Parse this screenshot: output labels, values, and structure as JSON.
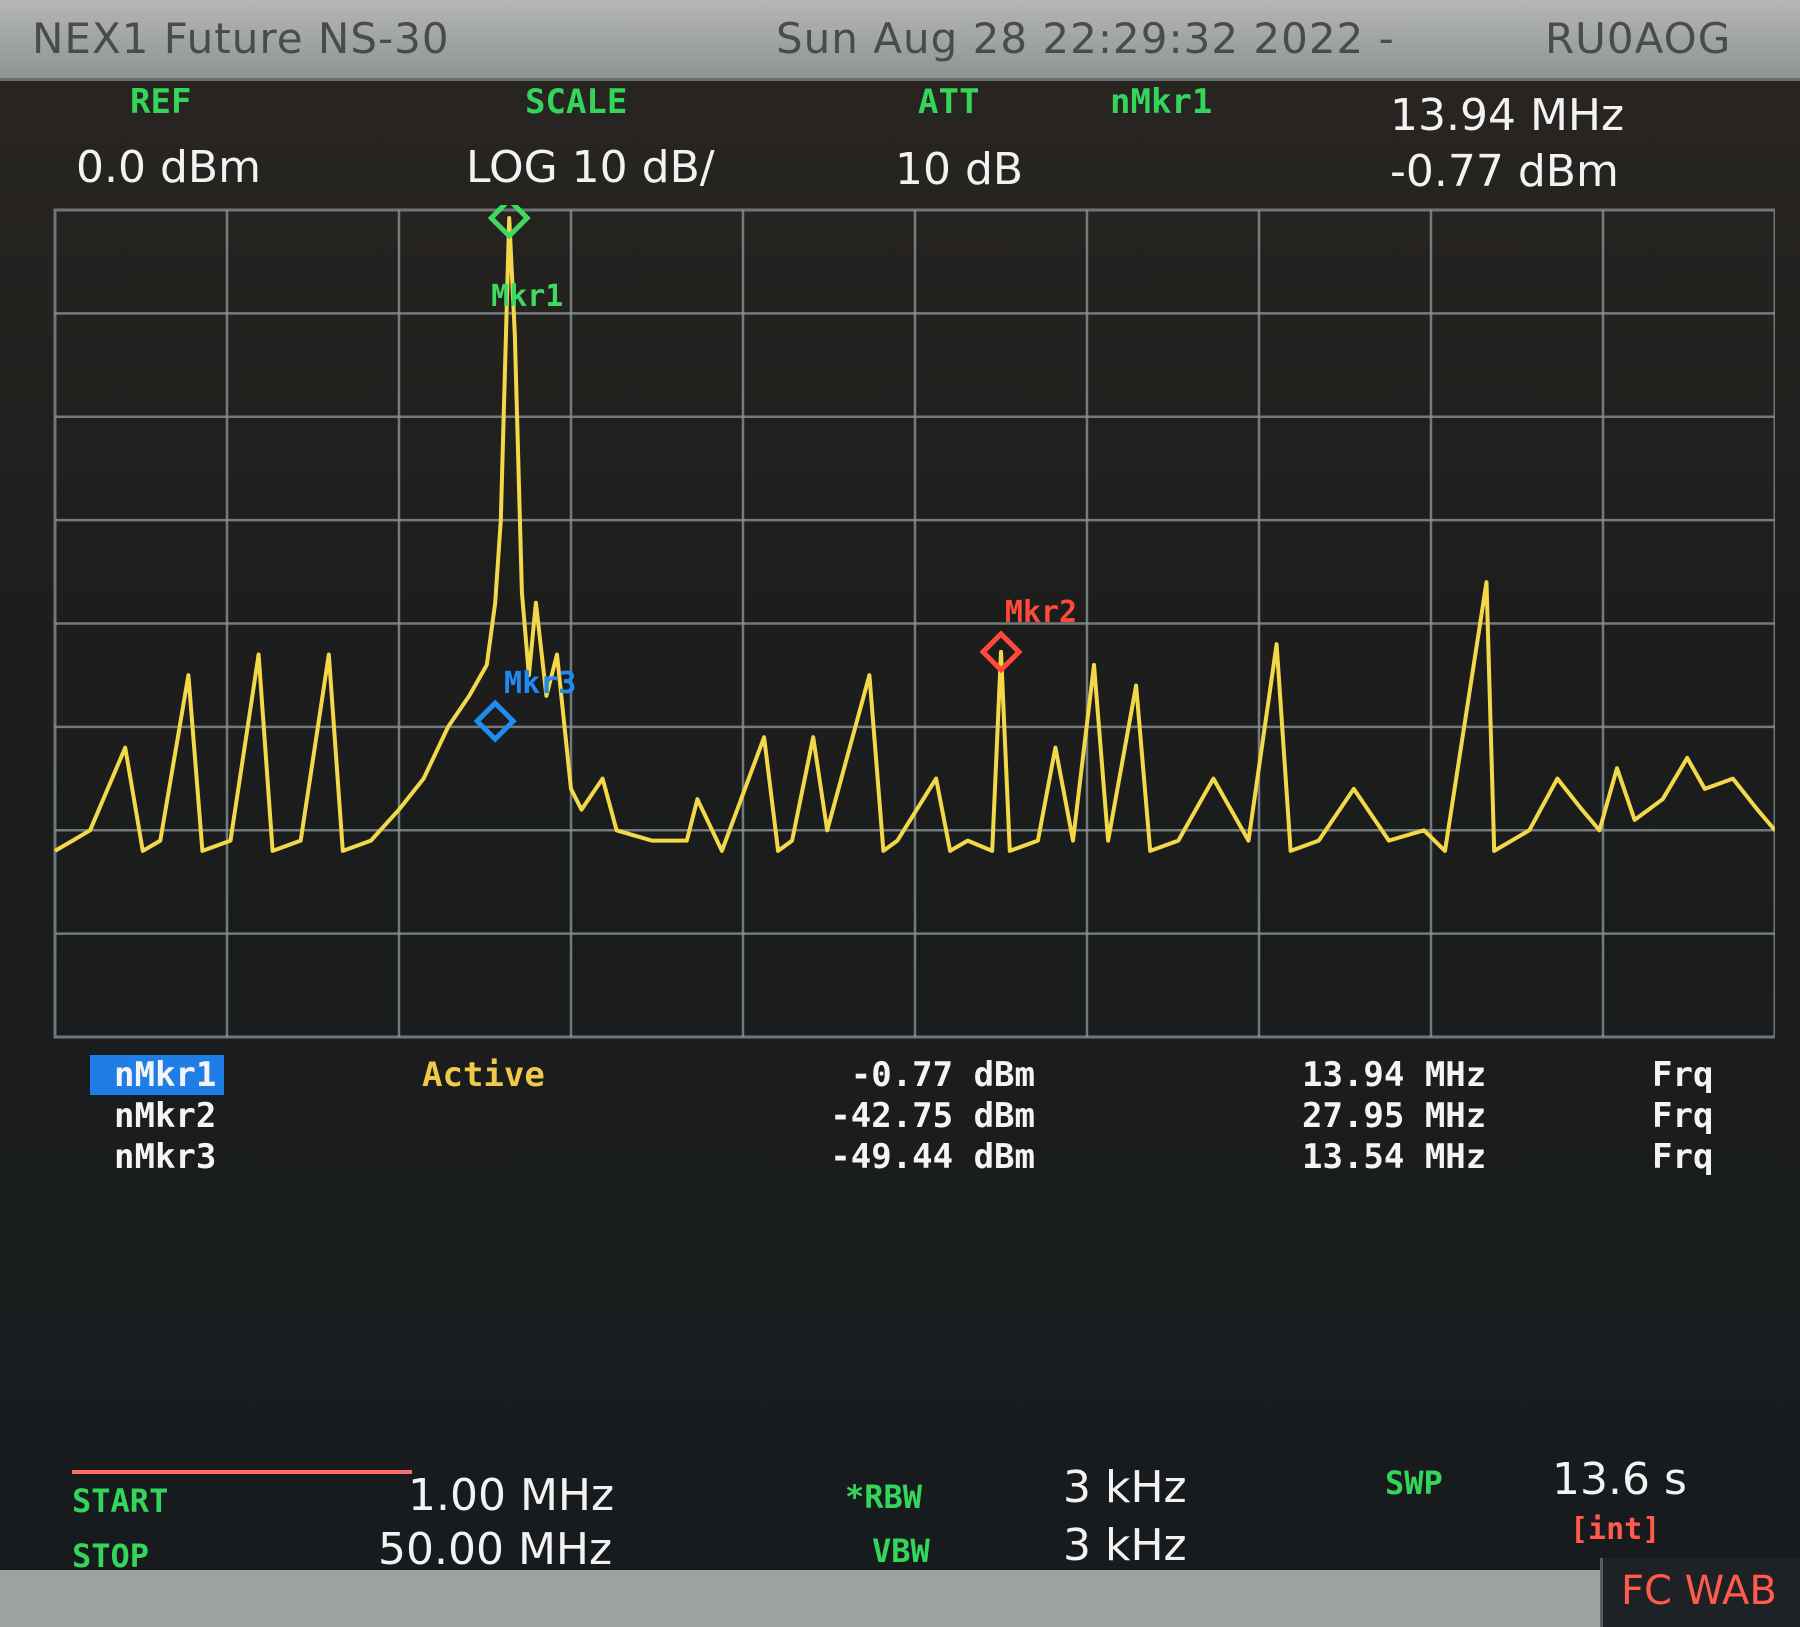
{
  "title_bar": {
    "instrument": "NEX1 Future NS-30",
    "datetime": "Sun Aug 28 22:29:32 2022 -",
    "callsign": "RU0AOG"
  },
  "header": {
    "ref_label": "REF",
    "ref_value": "0.0 dBm",
    "scale_label": "SCALE",
    "scale_value": "LOG 10 dB/",
    "att_label": "ATT",
    "att_value": "10 dB",
    "active_marker_label": "nMkr1",
    "active_marker_freq": "13.94 MHz",
    "active_marker_level": "-0.77 dBm"
  },
  "plot": {
    "marker_labels": {
      "mkr1": "Mkr1",
      "mkr2": "Mkr2",
      "mkr3": "Mkr3"
    }
  },
  "marker_table": {
    "rows": [
      {
        "name": "nMkr1",
        "state": "Active",
        "level": "-0.77 dBm",
        "freq": "13.94 MHz",
        "mode": "Frq",
        "selected": true
      },
      {
        "name": "nMkr2",
        "state": "",
        "level": "-42.75 dBm",
        "freq": "27.95 MHz",
        "mode": "Frq",
        "selected": false
      },
      {
        "name": "nMkr3",
        "state": "",
        "level": "-49.44 dBm",
        "freq": "13.54 MHz",
        "mode": "Frq",
        "selected": false
      }
    ]
  },
  "bottom": {
    "start_label": "START",
    "start_value": "1.00 MHz",
    "stop_label": "STOP",
    "stop_value": "50.00 MHz",
    "rbw_label": "*RBW",
    "rbw_value": "3 kHz",
    "vbw_label": "VBW",
    "vbw_value": "3 kHz",
    "swp_label": "SWP",
    "swp_value": "13.6 s",
    "swp_mode": "[int]"
  },
  "statusbar": {
    "tag": "FC WAB"
  },
  "colors": {
    "trace": "#f3d84a",
    "grid": "#8a9296",
    "mkr1": "#3fd860",
    "mkr2": "#ff4a3a",
    "mkr3": "#1e8cf0",
    "label_green": "#33d65a",
    "active_text": "#f1c94a",
    "selected_row_bg": "#1f7ee6"
  },
  "chart_data": {
    "type": "line",
    "title": "",
    "xlabel": "",
    "ylabel": "",
    "xlim": [
      1.0,
      50.0
    ],
    "ylim": [
      -80,
      0
    ],
    "x_unit": "MHz",
    "y_unit": "dBm",
    "grid": true,
    "series": [
      {
        "points": [
          [
            1.0,
            -62
          ],
          [
            1.5,
            -61
          ],
          [
            2.0,
            -60
          ],
          [
            3.0,
            -52
          ],
          [
            3.5,
            -62
          ],
          [
            4.0,
            -61
          ],
          [
            4.8,
            -45
          ],
          [
            5.2,
            -62
          ],
          [
            6.0,
            -61
          ],
          [
            6.8,
            -43
          ],
          [
            7.2,
            -62
          ],
          [
            8.0,
            -61
          ],
          [
            8.8,
            -43
          ],
          [
            9.2,
            -62
          ],
          [
            10.0,
            -61
          ],
          [
            10.8,
            -58
          ],
          [
            11.5,
            -55
          ],
          [
            12.2,
            -50
          ],
          [
            12.8,
            -47
          ],
          [
            13.3,
            -44
          ],
          [
            13.54,
            -38
          ],
          [
            13.7,
            -30
          ],
          [
            13.94,
            -0.77
          ],
          [
            14.1,
            -12
          ],
          [
            14.3,
            -37
          ],
          [
            14.5,
            -45
          ],
          [
            14.7,
            -38
          ],
          [
            15.0,
            -47
          ],
          [
            15.3,
            -43
          ],
          [
            15.7,
            -56
          ],
          [
            16.0,
            -58
          ],
          [
            16.6,
            -55
          ],
          [
            17.0,
            -60
          ],
          [
            18.0,
            -61
          ],
          [
            19.0,
            -61
          ],
          [
            19.3,
            -57
          ],
          [
            20.0,
            -62
          ],
          [
            21.2,
            -51
          ],
          [
            21.6,
            -62
          ],
          [
            22.0,
            -61
          ],
          [
            22.6,
            -51
          ],
          [
            23.0,
            -60
          ],
          [
            24.2,
            -45
          ],
          [
            24.6,
            -62
          ],
          [
            25.0,
            -61
          ],
          [
            26.1,
            -55
          ],
          [
            26.5,
            -62
          ],
          [
            27.0,
            -61
          ],
          [
            27.7,
            -62
          ],
          [
            27.95,
            -42.75
          ],
          [
            28.2,
            -62
          ],
          [
            29.0,
            -61
          ],
          [
            29.5,
            -52
          ],
          [
            30.0,
            -61
          ],
          [
            30.6,
            -44
          ],
          [
            31.0,
            -61
          ],
          [
            31.8,
            -46
          ],
          [
            32.2,
            -62
          ],
          [
            33.0,
            -61
          ],
          [
            34.0,
            -55
          ],
          [
            35.0,
            -61
          ],
          [
            35.8,
            -42
          ],
          [
            36.2,
            -62
          ],
          [
            37.0,
            -61
          ],
          [
            38.0,
            -56
          ],
          [
            39.0,
            -61
          ],
          [
            40.0,
            -60
          ],
          [
            40.6,
            -62
          ],
          [
            41.78,
            -36
          ],
          [
            42.0,
            -62
          ],
          [
            43.0,
            -60
          ],
          [
            43.8,
            -55
          ],
          [
            44.5,
            -58
          ],
          [
            45.0,
            -60
          ],
          [
            45.5,
            -54
          ],
          [
            46.0,
            -59
          ],
          [
            46.8,
            -57
          ],
          [
            47.5,
            -53
          ],
          [
            48.0,
            -56
          ],
          [
            48.8,
            -55
          ],
          [
            49.5,
            -58
          ],
          [
            50.0,
            -60
          ]
        ]
      }
    ],
    "markers": [
      {
        "name": "Mkr1",
        "x": 13.94,
        "y": -0.77
      },
      {
        "name": "Mkr2",
        "x": 27.95,
        "y": -42.75
      },
      {
        "name": "Mkr3",
        "x": 13.54,
        "y": -49.44
      }
    ]
  }
}
